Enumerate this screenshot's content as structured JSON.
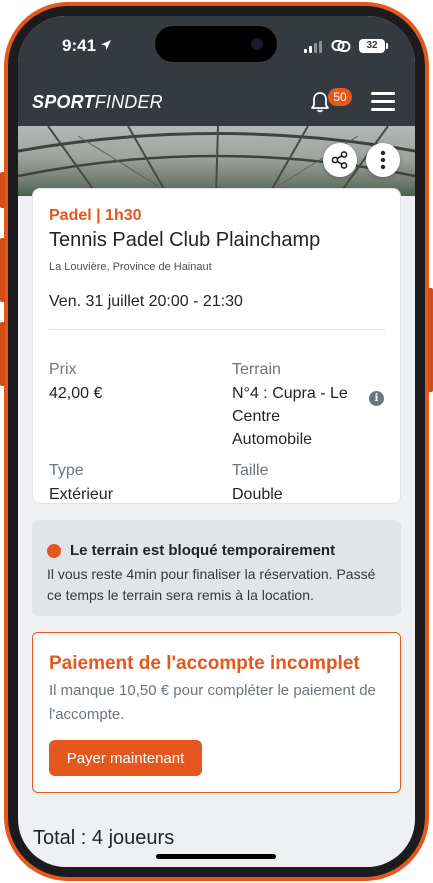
{
  "status_bar": {
    "time": "9:41",
    "battery": "32"
  },
  "header": {
    "logo_sport": "SPORT",
    "logo_finder": "FINDER",
    "notification_count": "50"
  },
  "booking": {
    "subtitle": "Padel | 1h30",
    "club_name": "Tennis Padel Club Plainchamp",
    "location": "La Louvière, Province de Hainaut",
    "datetime": "Ven. 31 juillet 20:00 - 21:30",
    "price_label": "Prix",
    "price_value": "42,00 €",
    "court_label": "Terrain",
    "court_value": "N°4 : Cupra - Le Centre Automobile",
    "type_label": "Type",
    "type_value": "Extérieur",
    "size_label": "Taille",
    "size_value": "Double"
  },
  "notice": {
    "title": "Le terrain est bloqué temporairement",
    "text": "Il vous reste 4min pour finaliser la réservation. Passé ce temps le terrain sera remis à la location."
  },
  "payment": {
    "title": "Paiement de l'accompte incomplet",
    "text": "Il manque 10,50 € pour compléter le paiement de l'accompte.",
    "button_label": "Payer maintenant"
  },
  "total": "Total : 4 joueurs",
  "colors": {
    "accent": "#e4571f",
    "header_bg": "#343a40",
    "screen_bg": "#eef0f2"
  },
  "icons": [
    "location-arrow-icon",
    "signal-icon",
    "link-icon",
    "battery-icon",
    "bell-icon",
    "menu-icon",
    "share-icon",
    "more-vertical-icon",
    "info-icon",
    "status-dot-icon"
  ]
}
